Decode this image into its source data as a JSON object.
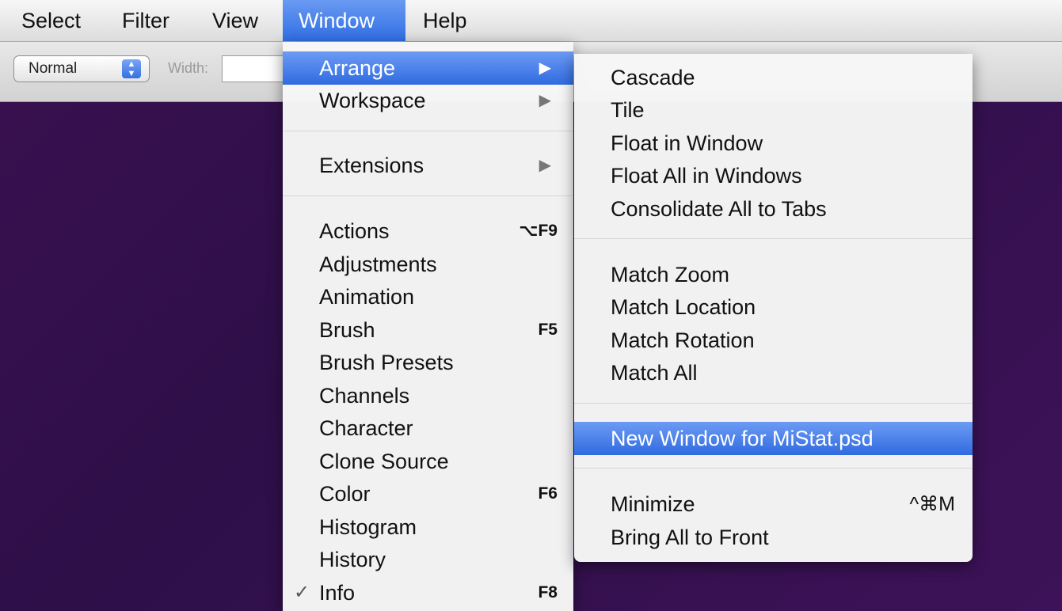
{
  "menubar": {
    "items": [
      {
        "label": "Select"
      },
      {
        "label": "Filter"
      },
      {
        "label": "View"
      },
      {
        "label": "Window"
      },
      {
        "label": "Help"
      }
    ],
    "active_index": 3
  },
  "options_bar": {
    "mode_value": "Normal",
    "width_label": "Width:",
    "width_value": ""
  },
  "window_menu": {
    "items": [
      {
        "label": "Arrange",
        "submenu": true,
        "highlighted": true
      },
      {
        "label": "Workspace",
        "submenu": true
      },
      {
        "label": "Extensions",
        "submenu": true
      },
      {
        "label": "Actions",
        "shortcut": "⌥F9"
      },
      {
        "label": "Adjustments"
      },
      {
        "label": "Animation"
      },
      {
        "label": "Brush",
        "shortcut": "F5"
      },
      {
        "label": "Brush Presets"
      },
      {
        "label": "Channels"
      },
      {
        "label": "Character"
      },
      {
        "label": "Clone Source"
      },
      {
        "label": "Color",
        "shortcut": "F6"
      },
      {
        "label": "Histogram"
      },
      {
        "label": "History"
      },
      {
        "label": "Info",
        "shortcut": "F8",
        "checked": true
      }
    ]
  },
  "arrange_submenu": {
    "items": [
      {
        "label": "Cascade"
      },
      {
        "label": "Tile"
      },
      {
        "label": "Float in Window"
      },
      {
        "label": "Float All in Windows"
      },
      {
        "label": "Consolidate All to Tabs"
      },
      {
        "label": "Match Zoom"
      },
      {
        "label": "Match Location"
      },
      {
        "label": "Match Rotation"
      },
      {
        "label": "Match All"
      },
      {
        "label": "New Window for MiStat.psd",
        "highlighted": true
      },
      {
        "label": "Minimize",
        "shortcut": "^⌘M"
      },
      {
        "label": "Bring All to Front"
      }
    ]
  },
  "icons": {
    "submenu_arrow": "triangle-right-icon",
    "checkmark": "checkmark-icon",
    "stepper": "up-down-stepper-icon"
  },
  "colors": {
    "highlight": "#2f6be0",
    "canvas_background": "#3a1050"
  }
}
